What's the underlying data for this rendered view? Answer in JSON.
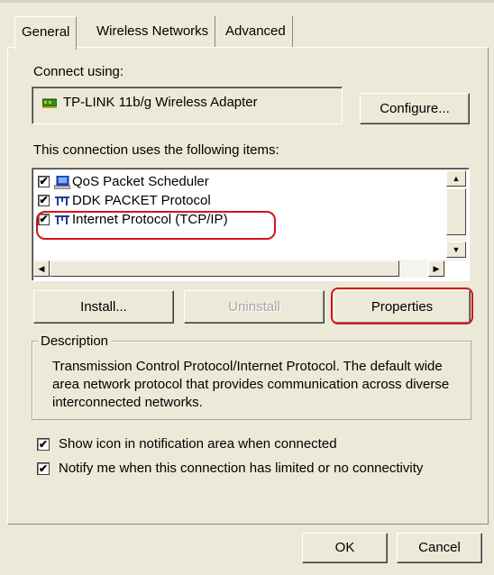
{
  "tabs": [
    {
      "label": "General",
      "active": true
    },
    {
      "label": "Wireless Networks",
      "active": false
    },
    {
      "label": "Advanced",
      "active": false
    }
  ],
  "connect_using": {
    "label": "Connect using:",
    "adapter": "TP-LINK 11b/g Wireless Adapter",
    "adapter_icon": "network-card-icon",
    "configure_button": "Configure..."
  },
  "items_section": {
    "label": "This connection uses the following items:",
    "items": [
      {
        "label": "QoS Packet Scheduler",
        "checked": true,
        "icon": "qos-scheduler-icon"
      },
      {
        "label": "DDK PACKET Protocol",
        "checked": true,
        "icon": "protocol-icon"
      },
      {
        "label": "Internet Protocol (TCP/IP)",
        "checked": true,
        "icon": "protocol-icon",
        "highlighted": true
      }
    ]
  },
  "buttons": {
    "install": "Install...",
    "uninstall": "Uninstall",
    "properties": "Properties",
    "ok": "OK",
    "cancel": "Cancel"
  },
  "description": {
    "legend": "Description",
    "text": "Transmission Control Protocol/Internet Protocol. The default wide area network protocol that provides communication across diverse interconnected networks."
  },
  "options": [
    {
      "label": "Show icon in notification area when connected",
      "checked": true
    },
    {
      "label": "Notify me when this connection has limited or no connectivity",
      "checked": true
    }
  ],
  "colors": {
    "dialog_bg": "#ece9d8",
    "highlight": "#d7141a"
  }
}
